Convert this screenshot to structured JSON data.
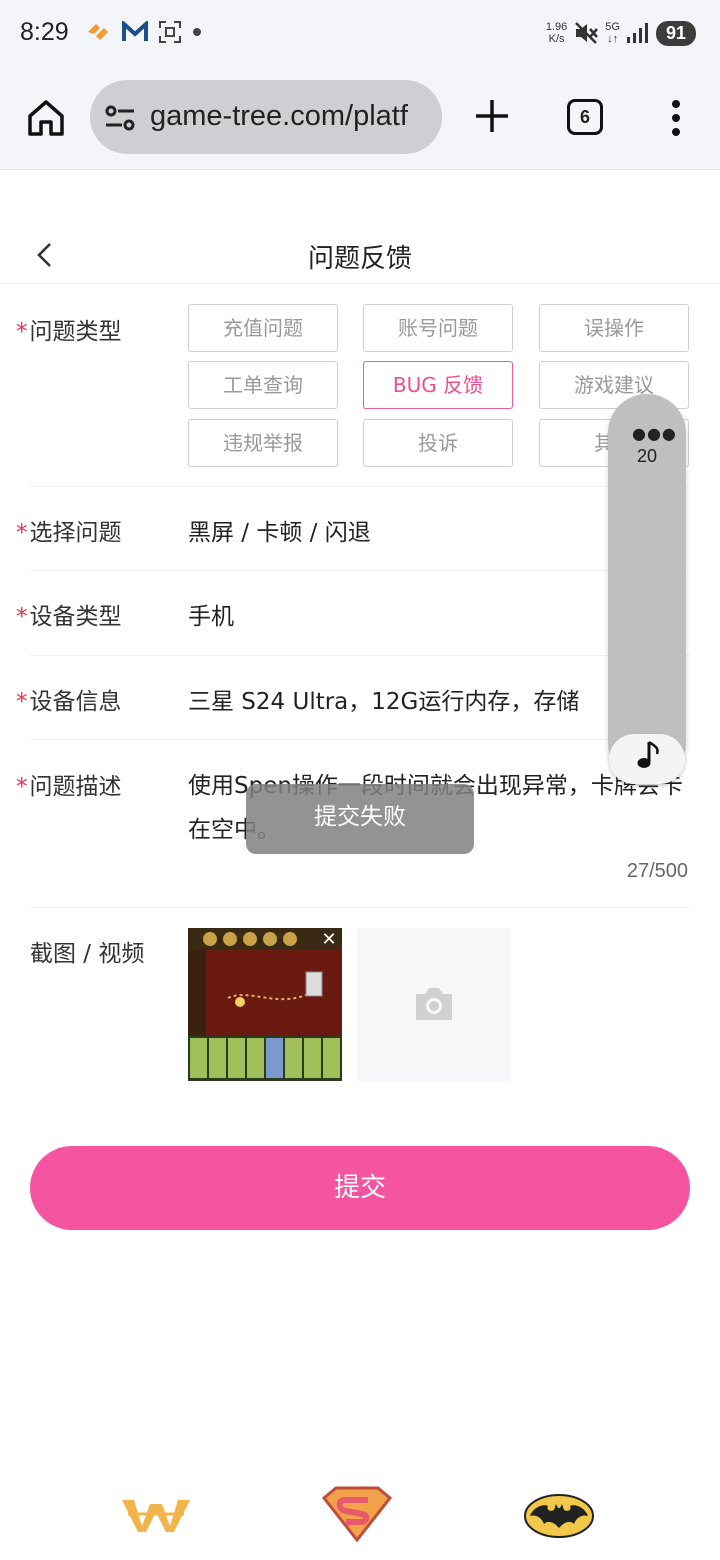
{
  "status_bar": {
    "time": "8:29",
    "net_speed_value": "1.96",
    "net_speed_unit": "K/s",
    "network_type": "5G",
    "battery": "91"
  },
  "browser": {
    "url": "game-tree.com/platf",
    "tab_count": "6"
  },
  "header": {
    "title": "问题反馈"
  },
  "form": {
    "required_mark": "*",
    "issue_type": {
      "label": "问题类型",
      "options": [
        "充值问题",
        "账号问题",
        "误操作",
        "工单查询",
        "BUG 反馈",
        "游戏建议",
        "违规举报",
        "投诉",
        "其"
      ],
      "selected": "BUG 反馈"
    },
    "select_issue": {
      "label": "选择问题",
      "value": "黑屏 / 卡顿 / 闪退"
    },
    "device_type": {
      "label": "设备类型",
      "value": "手机"
    },
    "device_info": {
      "label": "设备信息",
      "value": "三星 S24 Ultra，12G运行内存，存储"
    },
    "description": {
      "label": "问题描述",
      "value": "使用Spen操作一段时间就会出现异常，卡牌会卡在空中。",
      "counter": "27/500"
    },
    "media": {
      "label": "截图 / 视频"
    }
  },
  "submit": {
    "label": "提交"
  },
  "floating_widget": {
    "count": "20"
  },
  "toast": {
    "message": "提交失败"
  },
  "colors": {
    "accent": "#f454a0",
    "chip_active": "#ec4f8f",
    "required": "#e5344b"
  }
}
